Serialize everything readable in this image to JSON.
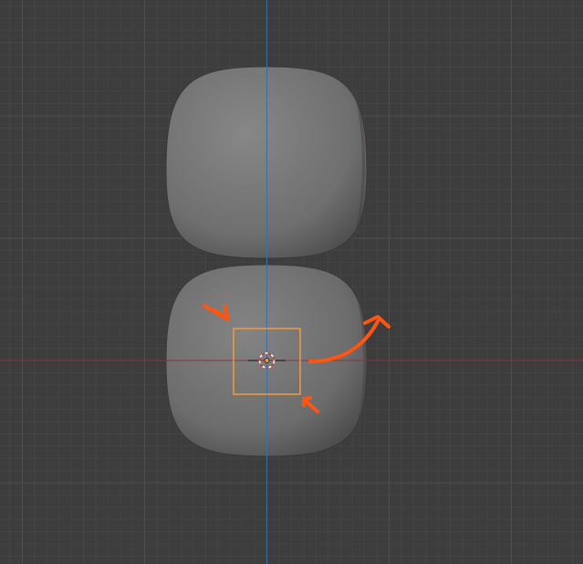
{
  "viewport": {
    "view": "top-orthographic",
    "grid": true,
    "axes_shown": [
      "x",
      "y"
    ],
    "colors": {
      "background": "#3d3d3d",
      "grid_minor": "#444444",
      "grid_major": "#4f4f4f",
      "x_axis": "#8a3340",
      "y_axis": "#3d6ea8",
      "mesh": "#808080",
      "selection": "#f39a3a",
      "annotation": "#ff5511"
    }
  },
  "scene": {
    "objects": [
      {
        "name": "upper-rounded-cube",
        "selected": false
      },
      {
        "name": "lower-rounded-cube",
        "selected": true
      }
    ],
    "object_origin": "object-origin-icon",
    "cursor_3d": "3d-cursor-icon"
  },
  "annotations": {
    "arrows": [
      "pointing-arrow-icon",
      "curved-arrow-icon",
      "corner-arrow-icon"
    ]
  }
}
